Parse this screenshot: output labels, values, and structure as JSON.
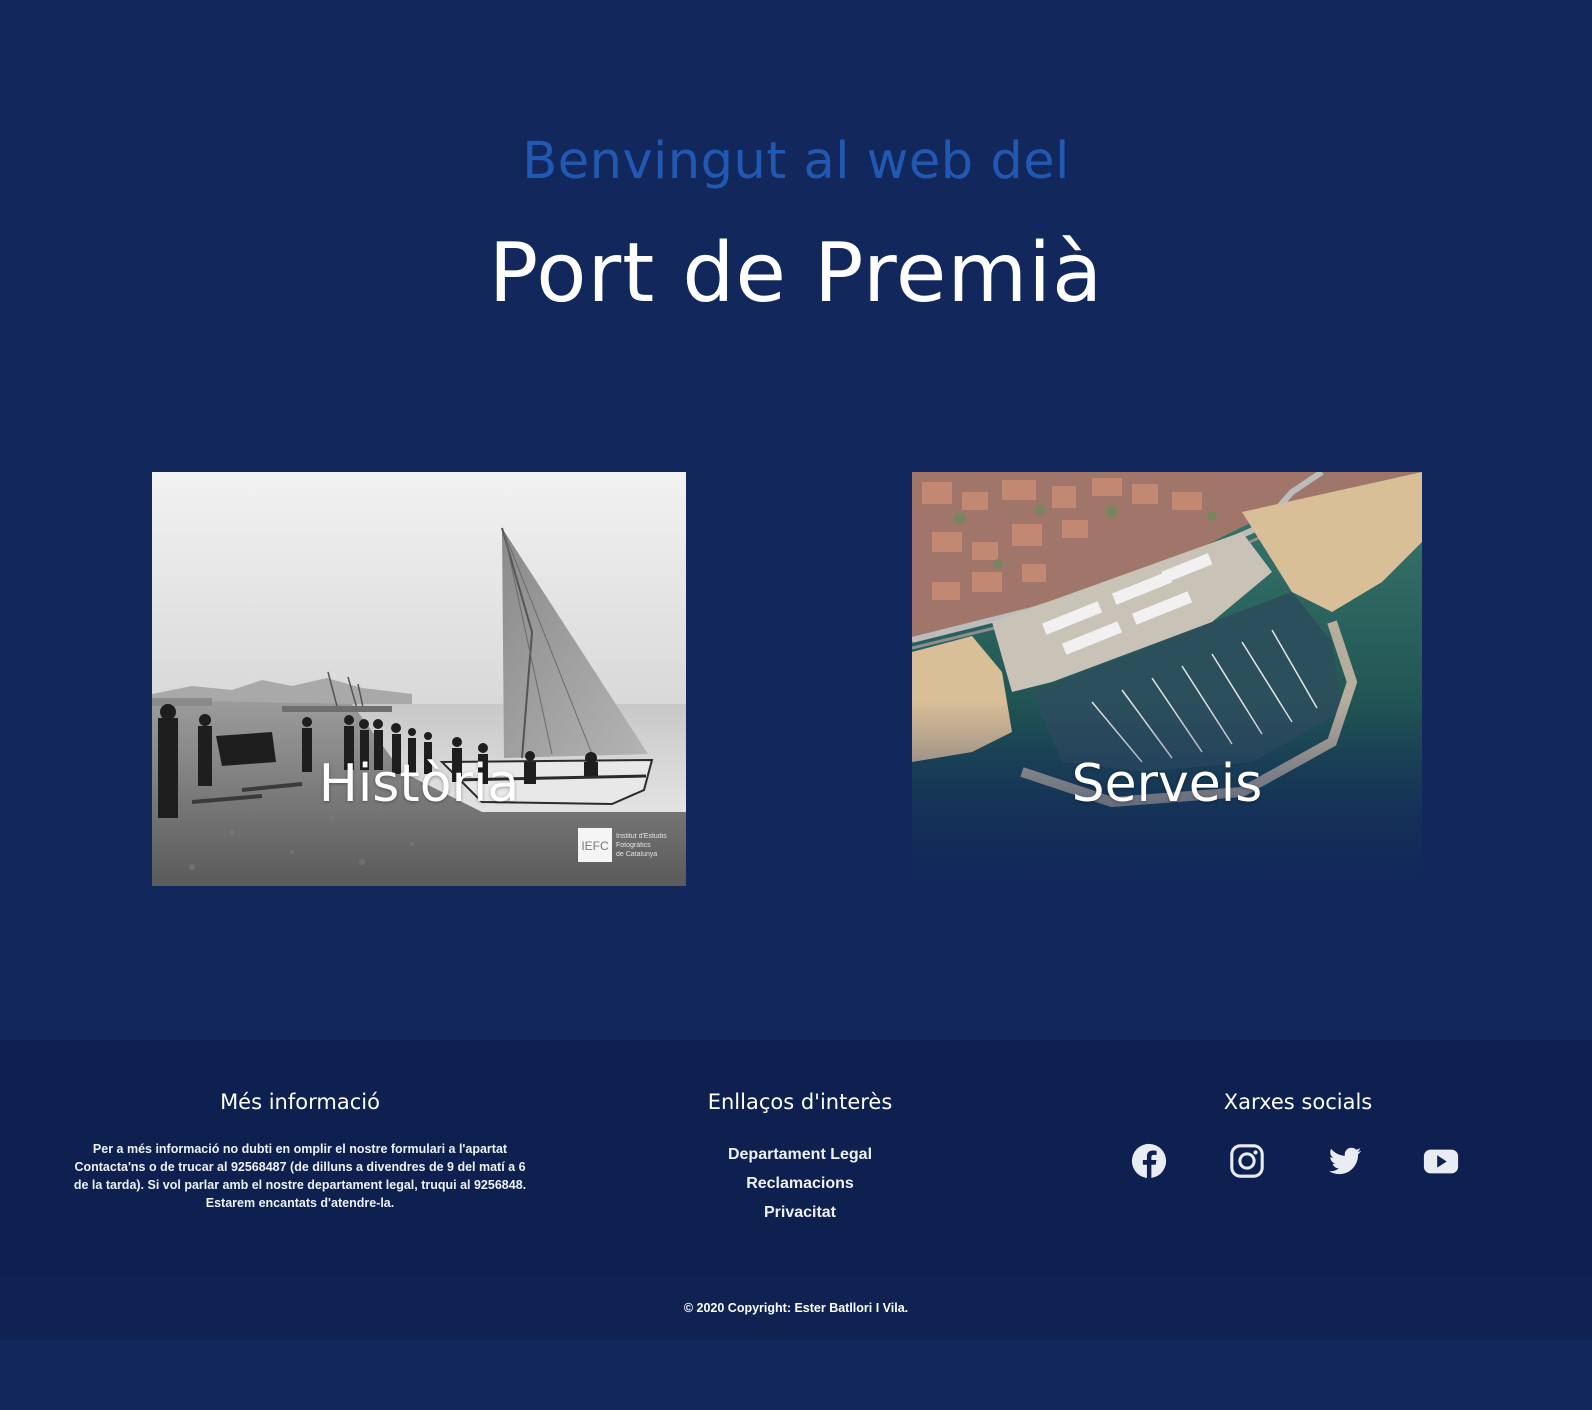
{
  "hero": {
    "kicker": "Benvingut al web del",
    "title": "Port de Premià"
  },
  "cards": [
    {
      "label": "Història",
      "image": "historic black-and-white photo of a sailing boat on the beach",
      "watermark": "IEFC",
      "watermark_sub": "Institut d'Estudis Fotogràfics de Catalunya"
    },
    {
      "label": "Serveis",
      "image": "aerial view of the marina"
    }
  ],
  "footer": {
    "info": {
      "heading": "Més informació",
      "text": "Per a més informació no dubti en omplir el nostre formulari a l'apartat Contacta'ns o de trucar al 92568487 (de dilluns a divendres de 9 del matí a 6 de la tarda). Si vol parlar amb el nostre departament legal, truqui al 9256848. Estarem encantats d'atendre-la."
    },
    "links": {
      "heading": "Enllaços d'interès",
      "items": [
        "Departament Legal",
        "Reclamacions",
        "Privacitat"
      ]
    },
    "social": {
      "heading": "Xarxes socials",
      "icons": [
        "facebook-icon",
        "instagram-icon",
        "twitter-icon",
        "youtube-icon"
      ]
    },
    "copyright": "© 2020 Copyright: Ester Batllori I Vila."
  },
  "colors": {
    "background": "#12285d",
    "footer": "#0d2050",
    "accent": "#2058b2",
    "text": "#ffffff"
  }
}
